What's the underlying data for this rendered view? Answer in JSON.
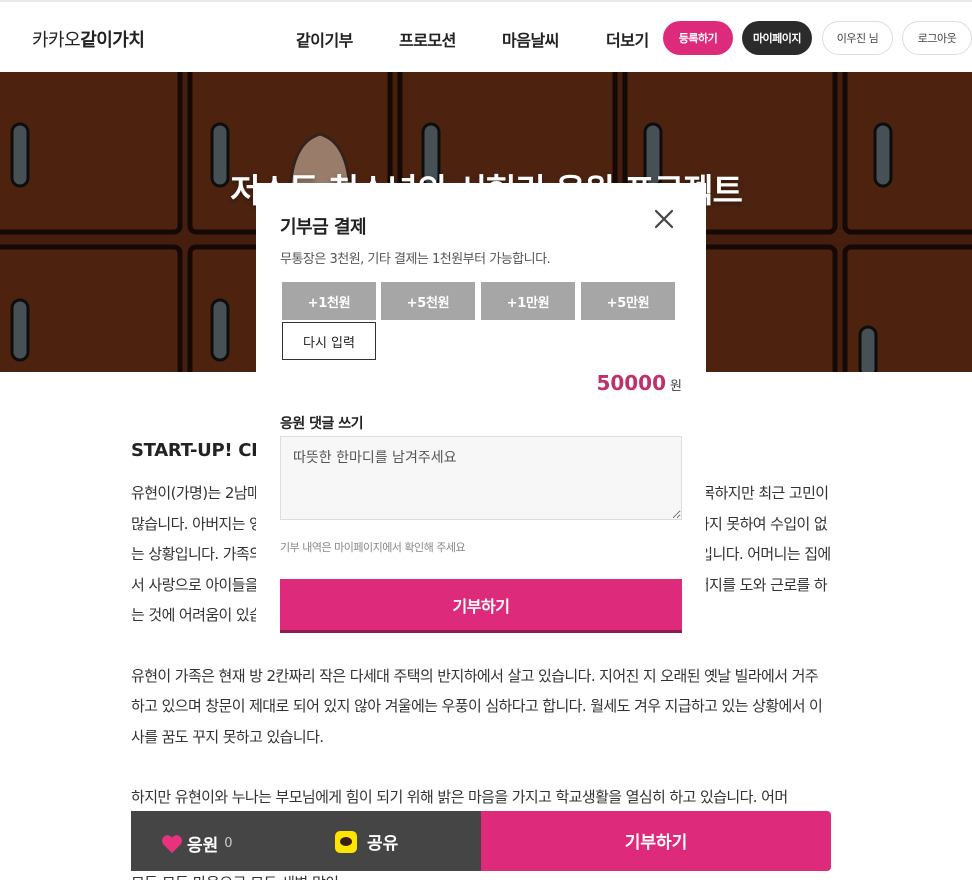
{
  "header": {
    "logo_light": "카카오",
    "logo_bold": "같이가치",
    "nav": [
      "같이기부",
      "프로모션",
      "마음날씨",
      "더보기"
    ],
    "register_label": "등록하기",
    "mypage_label": "마이페이지",
    "user_label": "이우진 님",
    "logout_label": "로그아웃"
  },
  "hero": {
    "title": "저소득 청소년의 시험리 응원 프로젝트"
  },
  "article": {
    "heading": "START-UP! CHANGE",
    "paragraphs": [
      "유현이(가명)는 2남매 중 막내로 아버지, 어머니, 누나와 함께 살고 있습니다. 유현이의 가족은 화목하지만 최근 고민이 많습니다. 아버지는 영세한 일용직으로 일하고 계시지만 일거리가 꾸준하지 않아 안정적인 일을 하지 못하여 수입이 없는 상황입니다. 가족의 생계를 위해 일을 해야 하지만 몸이 좋지 않아 꾸준히 일을 하기 힘든 상황입니다. 어머니는 집에서 사랑으로 아이들을 돌보고 계시지만 경제적으로 도움이 되지 못하는 것을 늘 미안해하시며 아버지를 도와 근로를 하는 것에 어려움이 있습니다.",
      "유현이 가족은 현재 방 2칸짜리 작은 다세대 주택의 반지하에서 살고 있습니다. 지어진 지 오래된 옛날 빌라에서 거주하고 있으며 창문이 제대로 되어 있지 않아 겨울에는 우풍이 심하다고 합니다. 월세도 겨우 지급하고 있는 상황에서 이사를 꿈도 꾸지 못하고 있습니다.",
      "하지만 유현이와 누나는 부모님에게 힘이 되기 위해 밝은 마음을 가지고 학교생활을 열심히 하고 있습니다. 어머"
    ],
    "trailing": "모든 모든 마음으로 모두 새벽 많이"
  },
  "modal": {
    "title": "기부금 결제",
    "description": "무통장은 3천원, 기타 결제는 1천원부터 가능합니다.",
    "amount_buttons": [
      "+1천원",
      "+5천원",
      "+1만원",
      "+5만원"
    ],
    "reset_label": "다시 입력",
    "amount": "50000",
    "amount_unit": "원",
    "comment_label": "응원 댓글 쓰기",
    "comment_placeholder": "따뜻한 한마디를 남겨주세요",
    "note": "기부 내역은 마이페이지에서 확인해 주세요",
    "submit_label": "기부하기"
  },
  "bottom_bar": {
    "cheer_label": "응원",
    "cheer_count": "0",
    "share_label": "공유",
    "donate_label": "기부하기"
  },
  "colors": {
    "accent": "#dd2a7b",
    "dark": "#2b2b2b",
    "overlay": "rgba(0,0,0,0.5)"
  }
}
